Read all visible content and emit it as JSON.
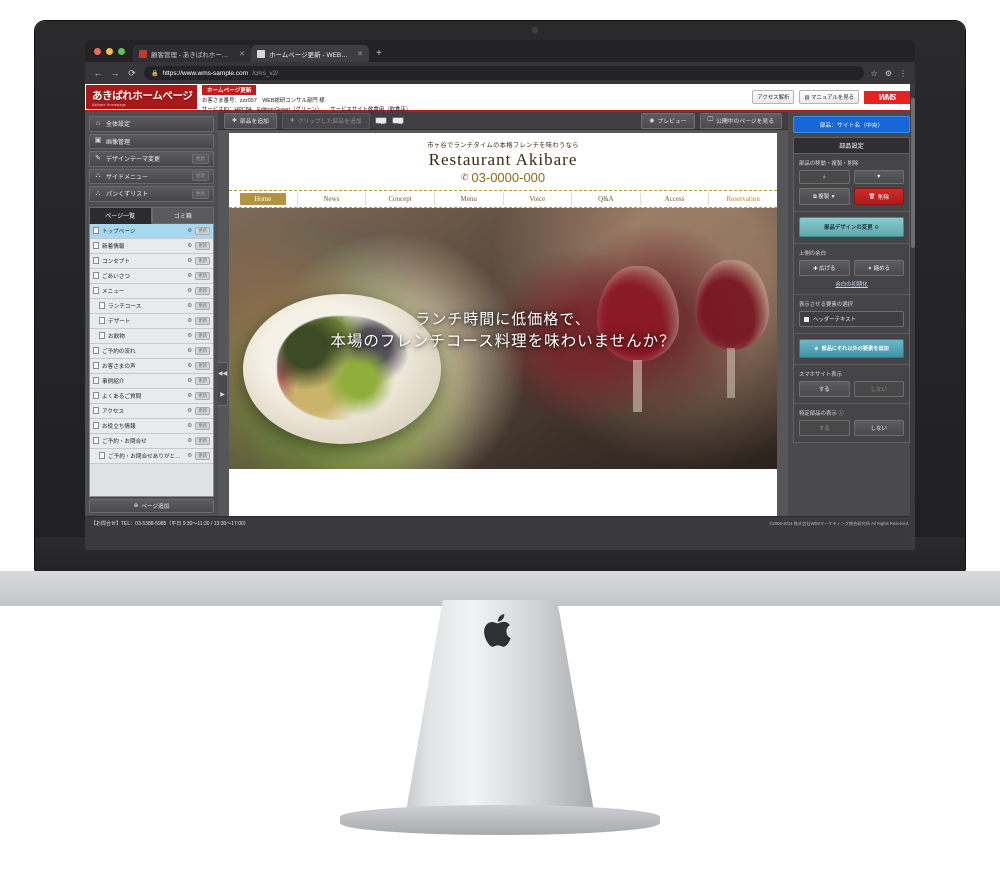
{
  "browser": {
    "tabs": [
      {
        "title": "顧客管理 - あきばれホームページ",
        "icon": "akibare-favicon",
        "active": false
      },
      {
        "title": "ホームページ更新 - WEB総研社内⋯",
        "icon": "page-favicon",
        "active": true
      }
    ],
    "newtab_label": "+",
    "back_icon": "←",
    "forward_icon": "→",
    "reload_icon": "⟳",
    "lock_icon": "🔒",
    "url_secure": "https://www.wms-sample.com",
    "url_path": "/cms_v2/",
    "star_icon": "☆",
    "extensions_icon": "⚙",
    "menu_icon": "⋮"
  },
  "cms_header": {
    "logo_main": "あきばれホームページ",
    "logo_sub": "Akibare Homepage",
    "tag": "ホームページ更新",
    "line1_label": "お客さま番号：",
    "line1_value": "zzz057　WEB総研コンサル部門 様",
    "line2": "サービスID：HPC84　Edition:Green（グリーン）　　サービスサイト飲食用（飲食店）",
    "btn_access": "アクセス解析",
    "btn_manual": "マニュアルを見る",
    "manual_icon": "book-icon",
    "brand_logo": "WMS"
  },
  "sidebar": {
    "menu": [
      {
        "label": "全体設定",
        "icon": "home-icon",
        "update": ""
      },
      {
        "label": "画像管理",
        "icon": "image-icon",
        "update": ""
      },
      {
        "label": "デザインテーマ変更",
        "icon": "pen-icon",
        "update": "更新"
      },
      {
        "label": "サイドメニュー",
        "icon": "tree-icon",
        "update": "更新"
      },
      {
        "label": "パンくずリスト",
        "icon": "tree-icon",
        "update": "更新"
      }
    ],
    "tabs": [
      {
        "label": "ページ一覧",
        "active": true
      },
      {
        "label": "ゴミ箱",
        "active": false
      }
    ],
    "pages": [
      {
        "label": "トップページ",
        "child": false,
        "selected": true,
        "update": "更新"
      },
      {
        "label": "新着情報",
        "child": false,
        "selected": false,
        "update": "更新"
      },
      {
        "label": "コンセプト",
        "child": false,
        "selected": false,
        "update": "更新"
      },
      {
        "label": "ごあいさつ",
        "child": false,
        "selected": false,
        "update": "更新"
      },
      {
        "label": "メニュー",
        "child": false,
        "selected": false,
        "update": "更新"
      },
      {
        "label": "ランチコース",
        "child": true,
        "selected": false,
        "update": "更新"
      },
      {
        "label": "デザート",
        "child": true,
        "selected": false,
        "update": "更新"
      },
      {
        "label": "お飲物",
        "child": true,
        "selected": false,
        "update": "更新"
      },
      {
        "label": "ご予約の流れ",
        "child": false,
        "selected": false,
        "update": "更新"
      },
      {
        "label": "お客さまの声",
        "child": false,
        "selected": false,
        "update": "更新"
      },
      {
        "label": "事例紹介",
        "child": false,
        "selected": false,
        "update": "更新"
      },
      {
        "label": "よくあるご質問",
        "child": false,
        "selected": false,
        "update": "更新"
      },
      {
        "label": "アクセス",
        "child": false,
        "selected": false,
        "update": "更新"
      },
      {
        "label": "お役立ち情報",
        "child": false,
        "selected": false,
        "update": "更新"
      },
      {
        "label": "ご予約・お問合せ",
        "child": false,
        "selected": false,
        "update": "更新"
      },
      {
        "label": "ご予約・お問合せありがとうご…",
        "child": true,
        "selected": false,
        "update": "更新"
      }
    ],
    "add_page": "ページ追加",
    "add_page_icon": "plus-circle-icon"
  },
  "toolbar": {
    "add_part": "部品を追加",
    "add_part_icon": "plus-icon",
    "add_clipped": "クリップした部品を追加",
    "add_clipped_icon": "plus-icon",
    "undo_icon": "undo-arrow-icon",
    "redo_icon": "redo-arrow-icon",
    "preview": "プレビュー",
    "preview_icon": "eye-icon",
    "view_live": "公開中のページを見る",
    "view_live_icon": "monitor-icon"
  },
  "site_preview": {
    "tagline": "市ヶ谷でランチタイムの本格フレンチを味わうなら",
    "title": "Restaurant Akibare",
    "phone": "03-0000-000",
    "phone_icon": "phone-icon",
    "nav": [
      {
        "label": "Home",
        "state": "active"
      },
      {
        "label": "News",
        "state": "normal"
      },
      {
        "label": "Concept",
        "state": "normal"
      },
      {
        "label": "Menu",
        "state": "normal"
      },
      {
        "label": "Voice",
        "state": "normal"
      },
      {
        "label": "Q&A",
        "state": "normal"
      },
      {
        "label": "Access",
        "state": "normal"
      },
      {
        "label": "Reservation",
        "state": "accent"
      }
    ],
    "hero_line1": "ランチ時間に低価格で、",
    "hero_line2": "本場のフレンチコース料理を味わいませんか？"
  },
  "right_panel": {
    "selection": "部品：サイト名（中央）",
    "panel_title": "部品設定",
    "move_label": "部品の移動・複製・削除",
    "move_up_icon": "chevron-up-icon",
    "move_down_icon": "chevron-down-icon",
    "duplicate": "複製",
    "duplicate_icon": "copy-icon",
    "duplicate_caret": "▼",
    "delete": "削除",
    "delete_icon": "trash-icon",
    "design_change": "部品デザインの変更",
    "design_change_icon": "gear-icon",
    "margin_label": "上側の余白",
    "margin_widen": "広げる",
    "margin_widen_icon": "plus-icon",
    "margin_narrow": "縮める",
    "margin_narrow_icon": "minus-icon",
    "margin_reset": "余白の初期化",
    "element_label": "表示させる要素の選択",
    "element_value": "ヘッダーテキスト",
    "add_other": "部品にそれ以外の要素を追加",
    "add_other_icon": "plus-circle-icon",
    "sp_label": "スマホサイト表示",
    "sp_on": "する",
    "sp_off": "しない",
    "sp_selected": "する",
    "special_label": "特定部品の表示",
    "special_info_icon": "info-icon",
    "special_on": "する",
    "special_off": "しない",
    "special_selected": "しない"
  },
  "app_footer": {
    "contact": "【お問合せ】TEL：03-5388-5985（平日 9:30〜11:30 / 13:30〜17:00）",
    "copyright": "©2006-2014 株式会社WEBマーケティング総合研究所 All Rights Reserved."
  },
  "colors": {
    "brand_red": "#a81818",
    "selection_blue": "#1767d8",
    "delete_red": "#bb1b1b",
    "teal": "#5fa8ae",
    "site_gold": "#b39243"
  }
}
